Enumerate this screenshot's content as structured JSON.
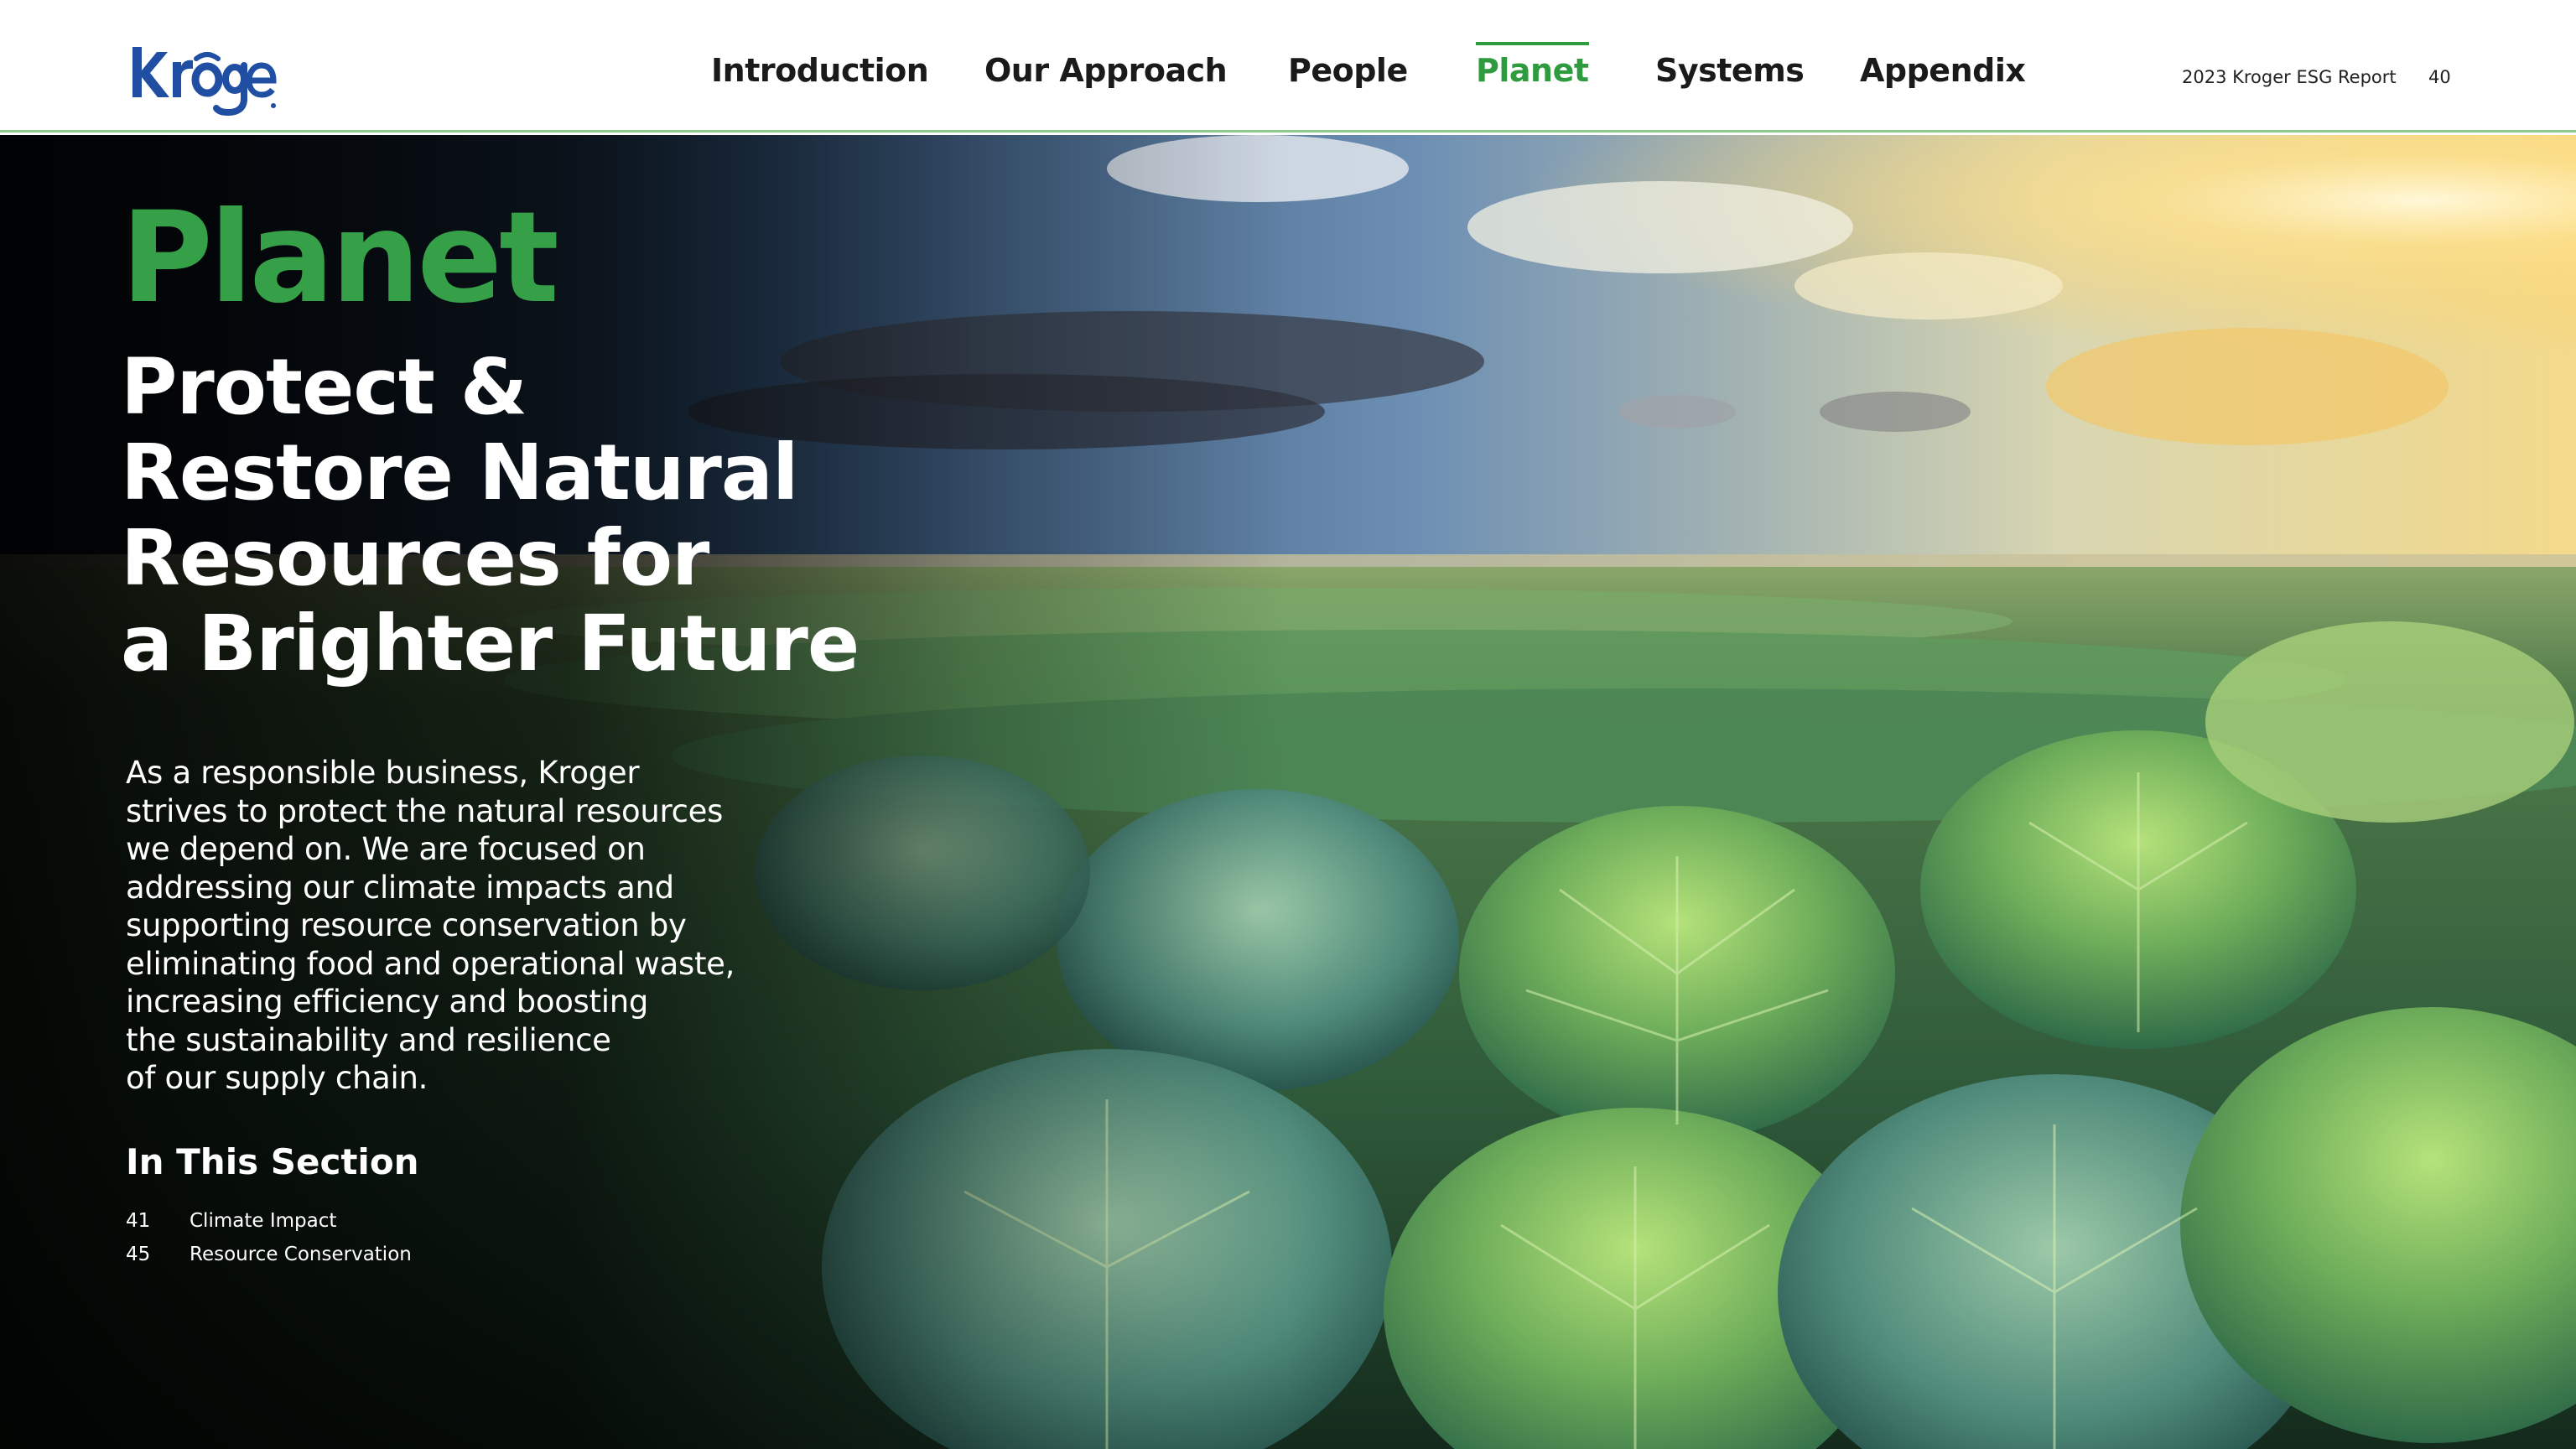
{
  "brand": {
    "logo_text": "Kroger",
    "logo_color": "#1f4ea2",
    "accent_green": "#35a048"
  },
  "nav": {
    "items": [
      {
        "label": "Introduction",
        "active": false
      },
      {
        "label": "Our Approach",
        "active": false
      },
      {
        "label": "People",
        "active": false
      },
      {
        "label": "Planet",
        "active": true
      },
      {
        "label": "Systems",
        "active": false
      },
      {
        "label": "Appendix",
        "active": false
      }
    ]
  },
  "report": {
    "title": "2023 Kroger ESG Report",
    "page": "40"
  },
  "hero": {
    "section_title": "Planet",
    "headline_lines": [
      "Protect &",
      "Restore Natural",
      "Resources for",
      "a Brighter Future"
    ],
    "intro_lines": [
      "As a responsible business, Kroger",
      "strives to protect the natural resources",
      "we depend on. We are focused on",
      "addressing our climate impacts and",
      "supporting resource conservation by",
      "eliminating food and operational waste,",
      "increasing efficiency and boosting",
      "the sustainability and resilience",
      "of our supply chain."
    ],
    "in_section_heading": "In This Section",
    "toc": [
      {
        "page": "41",
        "label": "Climate Impact"
      },
      {
        "page": "45",
        "label": "Resource Conservation"
      }
    ],
    "image_subject": "cabbage field at sunset"
  }
}
